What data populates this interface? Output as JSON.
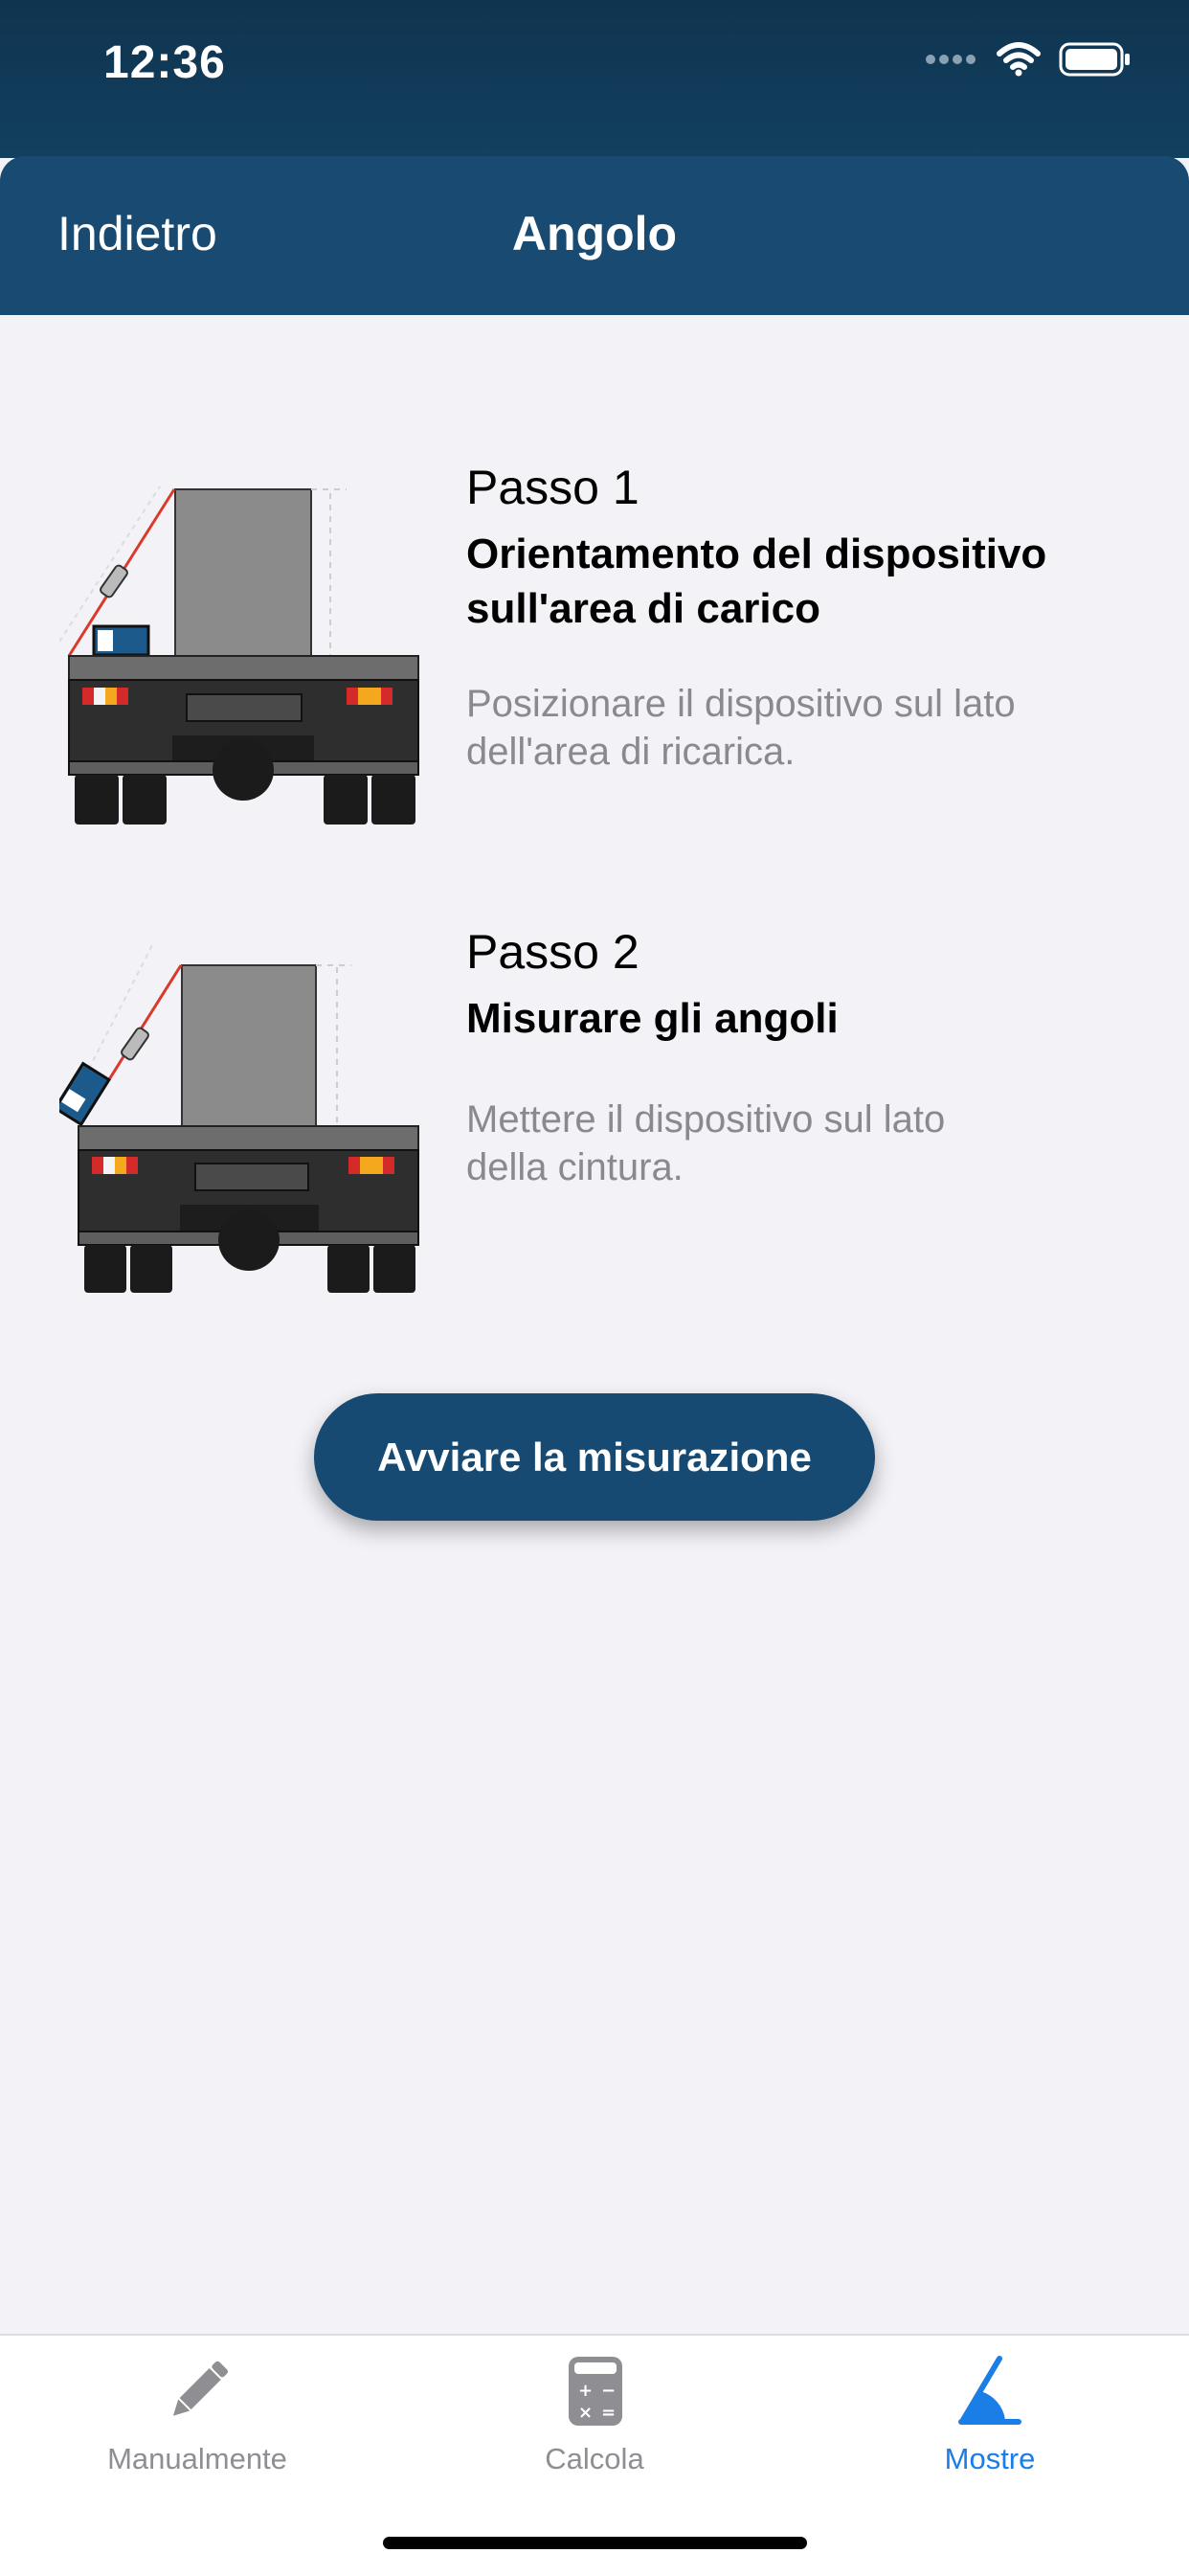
{
  "status": {
    "time": "12:36"
  },
  "nav": {
    "back_label": "Indietro",
    "title": "Angolo"
  },
  "steps": [
    {
      "title": "Passo 1",
      "subtitle_line1": "Orientamento del dispositivo",
      "subtitle_line2": "sull'area di carico",
      "desc_line1": "Posizionare il dispositivo sul lato",
      "desc_line2": "dell'area di ricarica."
    },
    {
      "title": "Passo 2",
      "subtitle_line1": "Misurare gli angoli",
      "desc_line1": "Mettere il dispositivo sul lato",
      "desc_line2": "della cintura."
    }
  ],
  "action": {
    "start_label": "Avviare la misurazione"
  },
  "tabs": [
    {
      "label": "Manualmente",
      "icon": "pencil-icon",
      "active": false
    },
    {
      "label": "Calcola",
      "icon": "calculator-icon",
      "active": false
    },
    {
      "label": "Mostre",
      "icon": "angle-icon",
      "active": true
    }
  ],
  "colors": {
    "primary": "#184a72",
    "active_tab": "#1a7ee6",
    "inactive_tab": "#8e8e93",
    "background": "#f2f2f7"
  }
}
